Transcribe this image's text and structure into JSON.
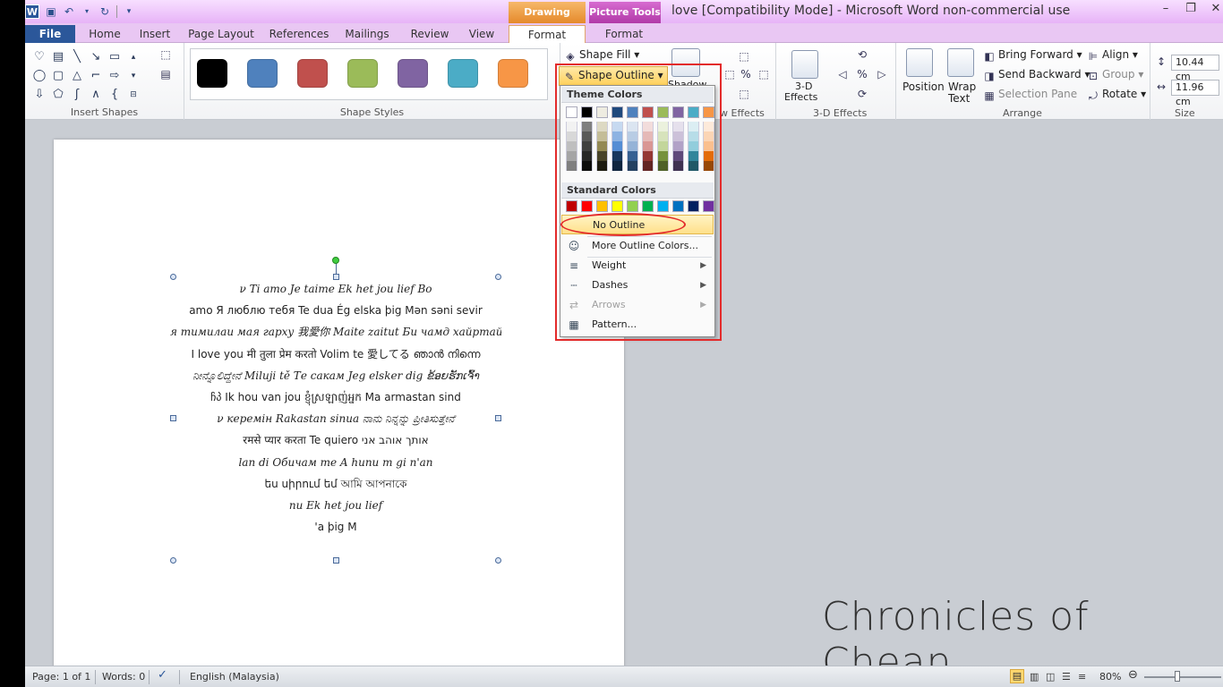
{
  "titlebar": {
    "context_drawing": "Drawing Tools",
    "context_picture": "Picture Tools",
    "window_title": "love [Compatibility Mode]  -  Microsoft Word non-commercial use"
  },
  "tabs": {
    "file": "File",
    "home": "Home",
    "insert": "Insert",
    "page_layout": "Page Layout",
    "references": "References",
    "mailings": "Mailings",
    "review": "Review",
    "view": "View",
    "format_drawing": "Format",
    "format_picture": "Format"
  },
  "ribbon": {
    "insert_shapes_label": "Insert Shapes",
    "shape_styles_label": "Shape Styles",
    "shape_fill": "Shape Fill",
    "shape_outline": "Shape Outline",
    "shadow_partial": "Shadow",
    "effects_partial": "w Effects",
    "three_d_effects_btn": "3-D",
    "three_d_effects_btn2": "Effects",
    "three_d_label": "3-D Effects",
    "position": "Position",
    "wrap": "Wrap",
    "wrap2": "Text",
    "bring_forward": "Bring Forward",
    "send_backward": "Send Backward",
    "selection_pane": "Selection Pane",
    "align": "Align",
    "group": "Group",
    "rotate": "Rotate",
    "arrange_label": "Arrange",
    "size_label": "Size",
    "height_value": "10.44 cm",
    "width_value": "11.96 cm"
  },
  "colors": {
    "swatches": [
      "#000000",
      "#4f81bd",
      "#c0504d",
      "#9bbb59",
      "#8064a2",
      "#4bacc6",
      "#f79646"
    ],
    "theme_top": [
      "#ffffff",
      "#000000",
      "#eeece1",
      "#1f497d",
      "#4f81bd",
      "#c0504d",
      "#9bbb59",
      "#8064a2",
      "#4bacc6",
      "#f79646"
    ],
    "theme_shades": [
      [
        "#f2f2f2",
        "#d8d8d8",
        "#bfbfbf",
        "#a5a5a5",
        "#7f7f7f"
      ],
      [
        "#7f7f7f",
        "#595959",
        "#3f3f3f",
        "#262626",
        "#0c0c0c"
      ],
      [
        "#ddd9c3",
        "#c4bd97",
        "#938953",
        "#494429",
        "#1d1b10"
      ],
      [
        "#c6d9f0",
        "#8db3e2",
        "#548dd4",
        "#17365d",
        "#0f243e"
      ],
      [
        "#dbe5f1",
        "#b8cce4",
        "#95b3d7",
        "#366092",
        "#244061"
      ],
      [
        "#f2dcdb",
        "#e5b9b7",
        "#d99694",
        "#953734",
        "#632423"
      ],
      [
        "#ebf1dd",
        "#d7e3bc",
        "#c3d69b",
        "#76923c",
        "#4f6128"
      ],
      [
        "#e5e0ec",
        "#ccc1d9",
        "#b2a2c7",
        "#5f497a",
        "#3f3151"
      ],
      [
        "#dbeef3",
        "#b7dde8",
        "#92cddc",
        "#31859b",
        "#205867"
      ],
      [
        "#fdeada",
        "#fbd5b5",
        "#fac08f",
        "#e36c09",
        "#974806"
      ]
    ],
    "standard": [
      "#c00000",
      "#ff0000",
      "#ffc000",
      "#ffff00",
      "#92d050",
      "#00b050",
      "#00b0f0",
      "#0070c0",
      "#002060",
      "#7030a0"
    ],
    "annotation_red": "#e32b2b"
  },
  "dropdown": {
    "theme_colors": "Theme Colors",
    "standard_colors": "Standard Colors",
    "no_outline": "No Outline",
    "more_colors": "More Outline Colors...",
    "weight": "Weight",
    "dashes": "Dashes",
    "arrows": "Arrows",
    "pattern": "Pattern..."
  },
  "document": {
    "lines": [
      "ν Ti amo  Je taime          Ek het jou lief  Bo",
      "amo  Я люблю тебя  Te dua  Ég elska þig   Mən səni sevir",
      "я тимилаи мая гарху  我愛你   Maite zaitut  Би чамд хайртай",
      "I love you  मी तुला प्रेम करतो  Volim te  愛してる  ഞാൻ നിന്നെ",
      "ನೀನ್ನೊಲಿದ್ದೇನೆ  Miluji tě  Те сакам  Jeg elsker dig  ຂ້ອຍຮັກເຈົ້າ",
      "ჩპ  Ik hou van jou  ខ្ញុំស្រឡាញ់អ្នក  Ma armastan sind",
      "ν керемін  Rakastan sinua  ನಾನು ನಿನ್ನನ್ನು ಪ್ರೀತಿಸುತ್ತೇನೆ",
      "रमसे प्यार करता  Te quiero   אותך אוהב אני",
      "lan di  Обичам те  A hunu m gi n'an",
      "ես սիրում եմ    আমি আপনাকে",
      "nu  Ek het jou lief",
      "'a þig    M"
    ]
  },
  "watermark": "Chronicles of Chean",
  "status": {
    "page": "Page: 1 of 1",
    "words": "Words: 0",
    "language": "English (Malaysia)",
    "zoom": "80%"
  }
}
